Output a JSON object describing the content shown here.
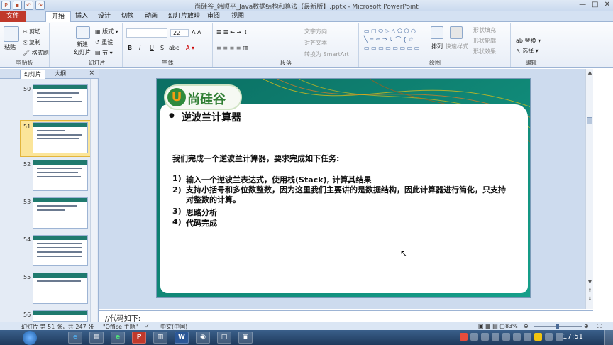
{
  "window": {
    "title": "尚硅谷_韩顺平_Java数据结构和算法【最新版】.pptx - Microsoft PowerPoint",
    "controls": {
      "min": "—",
      "max": "□",
      "close": "✕"
    }
  },
  "tabs": [
    "文件",
    "开始",
    "插入",
    "设计",
    "切换",
    "动画",
    "幻灯片放映",
    "审阅",
    "视图"
  ],
  "ribbon": {
    "clipboard": {
      "paste": "粘贴",
      "cut": "剪切",
      "copy": "复制",
      "format_painter": "格式刷",
      "label": "剪贴板"
    },
    "slides": {
      "new_slide": "新建\n幻灯片",
      "layout": "版式",
      "reset": "重设",
      "section": "节",
      "label": "幻灯片"
    },
    "font": {
      "size": "22",
      "label": "字体",
      "bold": "B",
      "italic": "I",
      "underline": "U",
      "shadow": "S",
      "strike": "abc"
    },
    "paragraph": {
      "text_direction": "文字方向",
      "align_text": "对齐文本",
      "smartart": "转换为 SmartArt",
      "label": "段落"
    },
    "drawing": {
      "arrange": "排列",
      "quick_styles": "快速样式",
      "shape_fill": "形状填充",
      "shape_outline": "形状轮廓",
      "shape_effects": "形状效果",
      "label": "绘图"
    },
    "editing": {
      "replace": "替换",
      "select": "选择",
      "label": "编辑"
    }
  },
  "left_pane": {
    "tabs": [
      "幻灯片",
      "大纲"
    ],
    "close": "×",
    "slide_numbers": [
      "50",
      "51",
      "52",
      "53",
      "54",
      "55",
      "56"
    ],
    "selected": "51"
  },
  "slide": {
    "logo_text": "尚硅谷",
    "bullet_title": "逆波兰计算器",
    "intro": "我们完成一个逆波兰计算器，要求完成如下任务:",
    "items": [
      {
        "num": "1)",
        "text": "输入一个逆波兰表达式，使用栈(Stack), 计算其结果"
      },
      {
        "num": "2)",
        "text": "支持小括号和多位数整数，因为这里我们主要讲的是数据结构，因此计算器进行简化，只支持对整数的计算。"
      },
      {
        "num": "3)",
        "text": "思路分析"
      },
      {
        "num": "4)",
        "text": "代码完成"
      }
    ]
  },
  "notes": "//代码如下:",
  "status": {
    "slide_info": "幻灯片 第 51 张，共 247 张",
    "theme": "\"Office 主题\"",
    "language": "中文(中国)",
    "zoom": "83%"
  },
  "taskbar": {
    "apps": [
      "e",
      "P",
      "e",
      "W",
      "◉",
      "□",
      "▣"
    ],
    "clock": "17:51"
  },
  "colors": {
    "slide_bg": "#0f8a77",
    "file_tab": "#c0392b",
    "selected_thumb": "#fbe59a"
  }
}
